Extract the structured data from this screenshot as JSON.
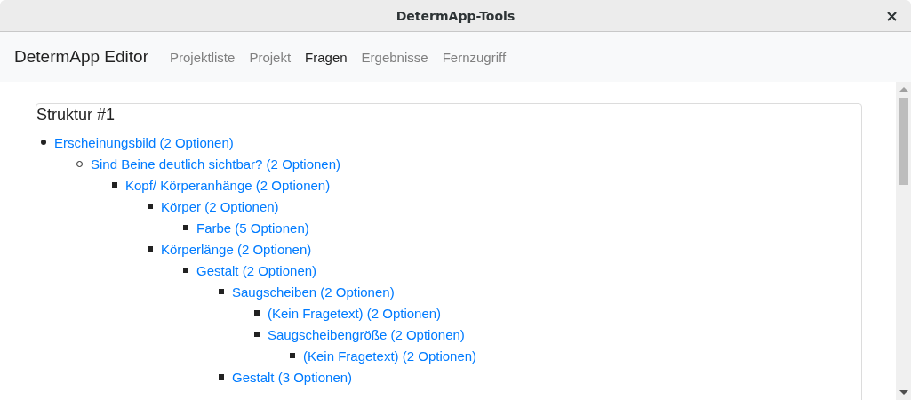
{
  "window": {
    "title": "DetermApp-Tools",
    "close": "×"
  },
  "navbar": {
    "brand": "DetermApp Editor",
    "links": [
      {
        "label": "Projektliste",
        "selected": false
      },
      {
        "label": "Projekt",
        "selected": false
      },
      {
        "label": "Fragen",
        "selected": true
      },
      {
        "label": "Ergebnisse",
        "selected": false
      },
      {
        "label": "Fernzugriff",
        "selected": false
      }
    ]
  },
  "card": {
    "title": "Struktur #1",
    "tree": [
      {
        "label": "Erscheinungsbild (2 Optionen)",
        "children": [
          {
            "label": "Sind Beine deutlich sichtbar? (2 Optionen)",
            "children": [
              {
                "label": "Kopf/ Körperanhänge (2 Optionen)",
                "children": [
                  {
                    "label": "Körper (2 Optionen)",
                    "children": [
                      {
                        "label": "Farbe (5 Optionen)"
                      }
                    ]
                  },
                  {
                    "label": "Körperlänge (2 Optionen)",
                    "children": [
                      {
                        "label": "Gestalt (2 Optionen)",
                        "children": [
                          {
                            "label": "Saugscheiben (2 Optionen)",
                            "children": [
                              {
                                "label": "(Kein Fragetext) (2 Optionen)"
                              },
                              {
                                "label": "Saugscheibengröße (2 Optionen)",
                                "children": [
                                  {
                                    "label": "(Kein Fragetext) (2 Optionen)"
                                  }
                                ]
                              }
                            ]
                          },
                          {
                            "label": "Gestalt (3 Optionen)"
                          }
                        ]
                      }
                    ]
                  }
                ]
              }
            ]
          }
        ]
      }
    ]
  }
}
